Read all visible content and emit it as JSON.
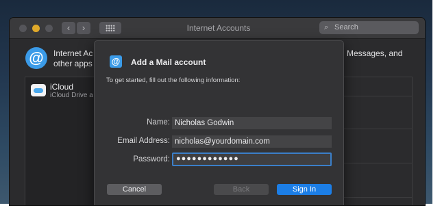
{
  "window": {
    "title": "Internet Accounts",
    "search_placeholder": "Search",
    "nav_back": "‹",
    "nav_forward": "›"
  },
  "info": {
    "line1": "Internet Ac",
    "line2": "other apps",
    "right_text": "Messages, and"
  },
  "sidebar": {
    "items": [
      {
        "name": "iCloud",
        "subtitle": "iCloud Drive a",
        "icon": "icloud-icon"
      }
    ]
  },
  "dialog": {
    "title": "Add a Mail account",
    "instruction": "To get started, fill out the following information:",
    "fields": {
      "name_label": "Name:",
      "name_value": "Nicholas Godwin",
      "email_label": "Email Address:",
      "email_value": "nicholas@yourdomain.com",
      "password_label": "Password:",
      "password_value": "●●●●●●●●●●●●"
    },
    "buttons": {
      "cancel": "Cancel",
      "back": "Back",
      "sign_in": "Sign In"
    }
  },
  "colors": {
    "accent": "#1c7ee6",
    "at_icon": "#3b9be8",
    "yellow_light": "#e0a92a"
  }
}
